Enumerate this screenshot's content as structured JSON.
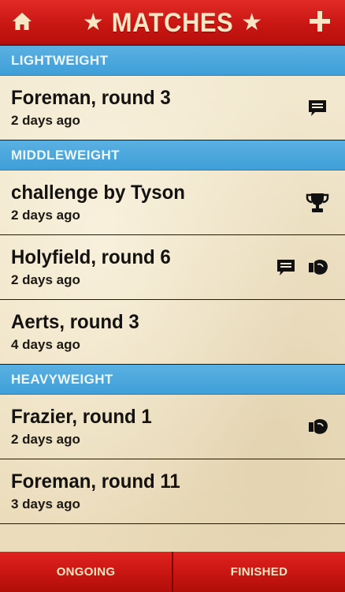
{
  "header": {
    "title": "MATCHES",
    "star_glyph": "★",
    "home_icon": "home-icon",
    "add_icon": "plus-icon"
  },
  "colors": {
    "topbar_red": "#c81612",
    "section_blue": "#3f9fd8",
    "parchment": "#efe3c6",
    "title_cream": "#f7e6c4"
  },
  "sections": [
    {
      "label": "LIGHTWEIGHT",
      "matches": [
        {
          "name": "Foreman, round 3",
          "time": "2 days ago",
          "icons": [
            "chat-icon"
          ]
        }
      ]
    },
    {
      "label": "MIDDLEWEIGHT",
      "matches": [
        {
          "name": "challenge by Tyson",
          "time": "2 days ago",
          "icons": [
            "trophy-icon"
          ]
        },
        {
          "name": "Holyfield, round 6",
          "time": "2 days ago",
          "icons": [
            "chat-icon",
            "boxing-glove-icon"
          ]
        },
        {
          "name": "Aerts, round 3",
          "time": "4 days ago",
          "icons": []
        }
      ]
    },
    {
      "label": "HEAVYWEIGHT",
      "matches": [
        {
          "name": "Frazier, round 1",
          "time": "2 days ago",
          "icons": [
            "boxing-glove-icon"
          ]
        },
        {
          "name": "Foreman, round 11",
          "time": "3 days ago",
          "icons": []
        }
      ]
    }
  ],
  "tabs": {
    "ongoing": "ONGOING",
    "finished": "FINISHED"
  }
}
